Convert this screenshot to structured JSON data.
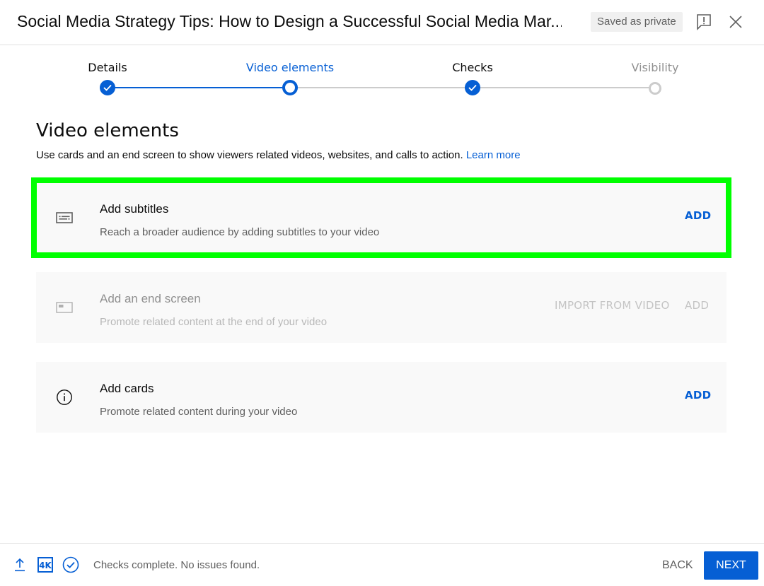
{
  "header": {
    "title": "Social Media Strategy Tips: How to Design a Successful Social Media Mar...",
    "saved_badge": "Saved as private",
    "feedback_icon": "feedback-icon",
    "close_icon": "close-icon"
  },
  "stepper": {
    "steps": [
      {
        "label": "Details",
        "state": "done"
      },
      {
        "label": "Video elements",
        "state": "current"
      },
      {
        "label": "Checks",
        "state": "done"
      },
      {
        "label": "Visibility",
        "state": "todo"
      }
    ]
  },
  "main": {
    "title": "Video elements",
    "description": "Use cards and an end screen to show viewers related videos, websites, and calls to action.",
    "learn_more": "Learn more",
    "cards": [
      {
        "icon": "subtitles-icon",
        "title": "Add subtitles",
        "description": "Reach a broader audience by adding subtitles to your video",
        "actions": [
          "ADD"
        ],
        "enabled": true,
        "highlighted": true
      },
      {
        "icon": "end-screen-icon",
        "title": "Add an end screen",
        "description": "Promote related content at the end of your video",
        "actions": [
          "IMPORT FROM VIDEO",
          "ADD"
        ],
        "enabled": false,
        "highlighted": false
      },
      {
        "icon": "info-icon",
        "title": "Add cards",
        "description": "Promote related content during your video",
        "actions": [
          "ADD"
        ],
        "enabled": true,
        "highlighted": false
      }
    ]
  },
  "footer": {
    "icons": [
      "upload-icon",
      "4k-icon",
      "check-circle-icon"
    ],
    "hd_label": "4K",
    "status": "Checks complete. No issues found.",
    "back_label": "BACK",
    "next_label": "NEXT"
  },
  "colors": {
    "accent": "#065fd4",
    "highlight": "#00ff00",
    "card_bg": "#f9f9f9"
  }
}
